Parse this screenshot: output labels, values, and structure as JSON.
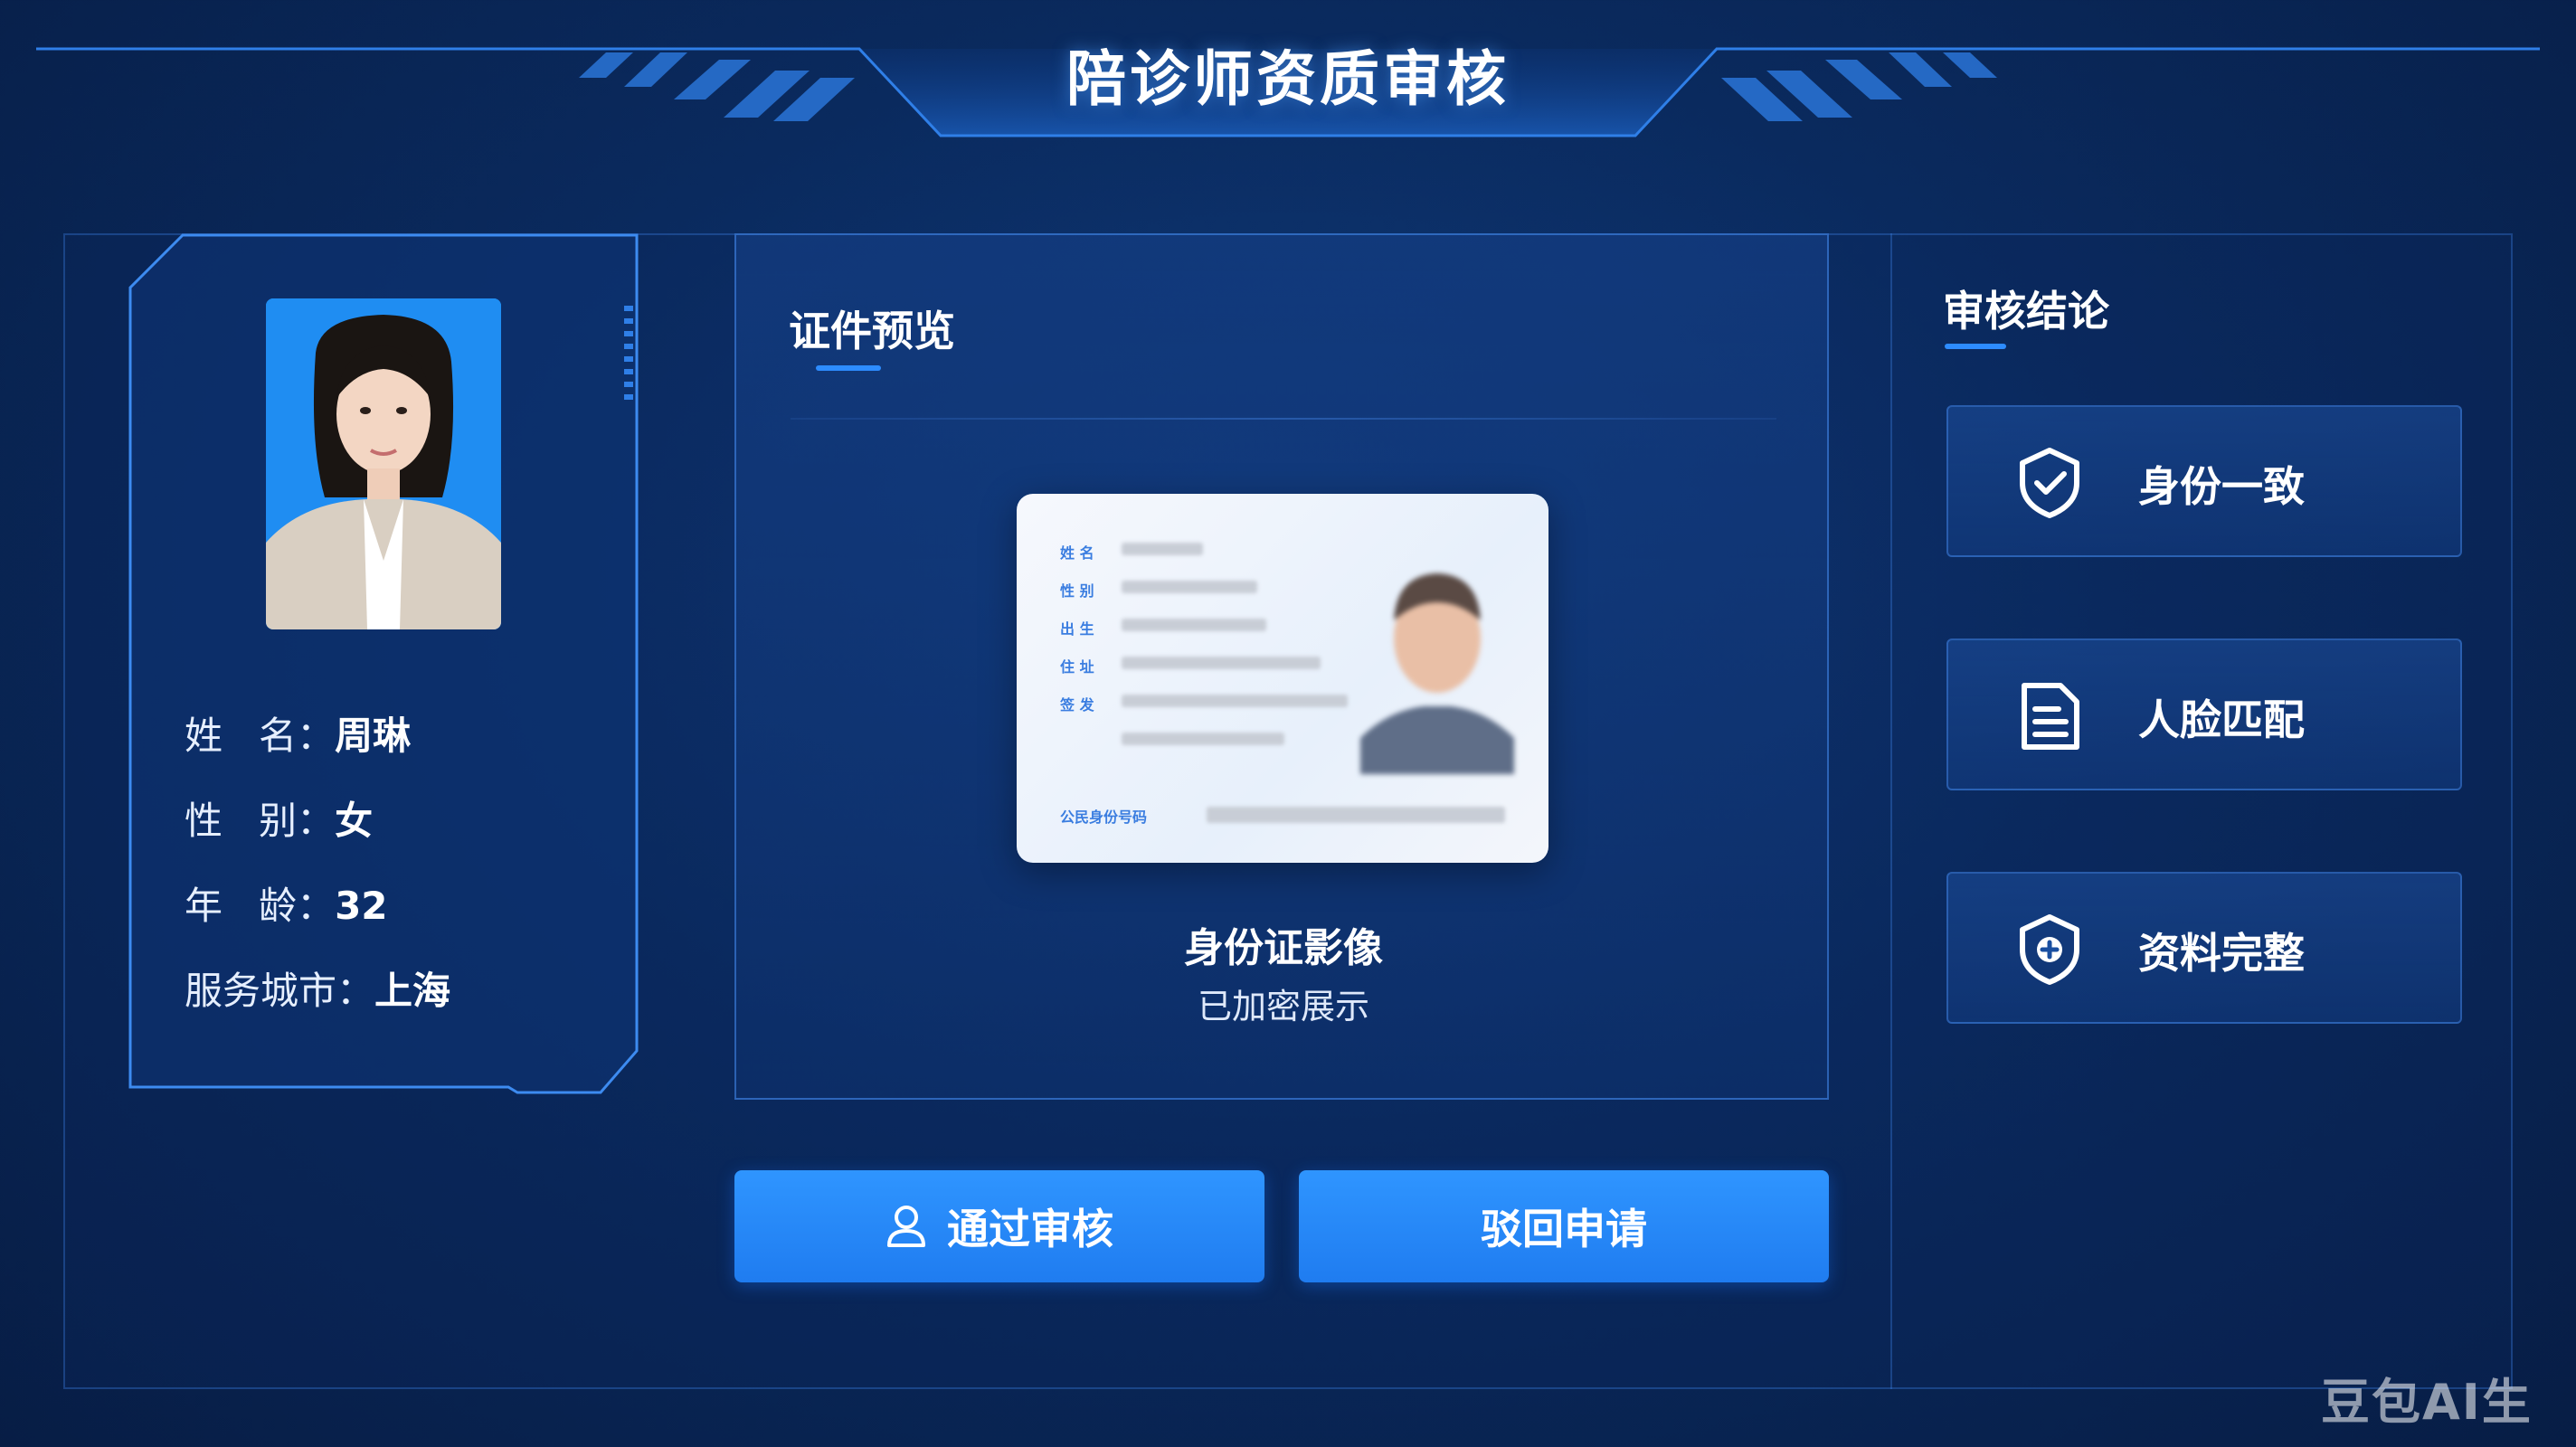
{
  "header": {
    "title": "陪诊师资质审核"
  },
  "profile": {
    "name_label": "姓   名：",
    "name": "周琳",
    "gender_label": "性   别：",
    "gender": "女",
    "age_label": "年   龄：",
    "age": "32",
    "city_label": "服务城市：",
    "city": "上海"
  },
  "preview": {
    "title": "证件预览",
    "card_caption": "身份证影像",
    "card_sub": "已加密展示",
    "card_labels": [
      "姓 名",
      "性 别",
      "出 生",
      "住 址",
      "签 发",
      "公民身份号码"
    ]
  },
  "actions": {
    "approve_label": "通过审核",
    "reject_label": "驳回申请"
  },
  "conclusion": {
    "title": "审核结论",
    "items": [
      {
        "label": "身份一致",
        "icon": "shield-check-icon"
      },
      {
        "label": "人脸匹配",
        "icon": "document-icon"
      },
      {
        "label": "资料完整",
        "icon": "shield-plus-icon"
      }
    ]
  },
  "watermark": "豆包AI生成",
  "colors": {
    "accent": "#2d8cff",
    "background": "#0a2a5e",
    "button": "#1f7cf0"
  }
}
